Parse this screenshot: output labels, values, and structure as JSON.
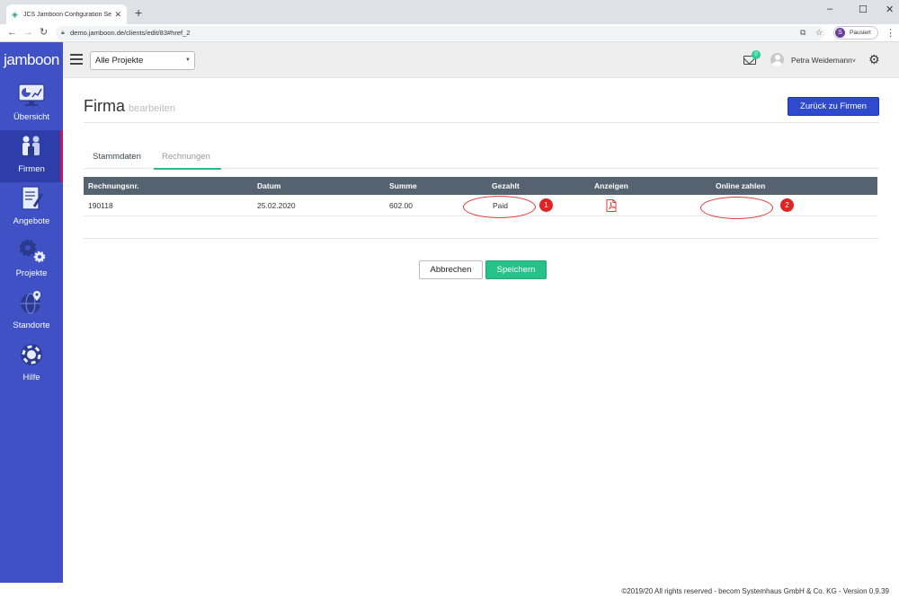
{
  "browser": {
    "tab_title": "JCS Jamboon Configuration Servi",
    "tab_close": "✕",
    "new_tab": "+",
    "url": "demo.jamboon.de/clients/edit/83#href_2",
    "profile_initial": "S",
    "profile_status": "Pausiert",
    "window_controls": [
      "–",
      "☐",
      "✕"
    ]
  },
  "app": {
    "brand": "jamboon",
    "project_select": "Alle Projekte",
    "mail_count": "0",
    "user_name": "Petra Weidemann",
    "accent_color": "#3f51c5"
  },
  "sidebar": {
    "items": [
      {
        "label": "Übersicht",
        "icon": "dashboard-icon",
        "active": false
      },
      {
        "label": "Firmen",
        "icon": "people-icon",
        "active": true
      },
      {
        "label": "Angebote",
        "icon": "document-edit-icon",
        "active": false
      },
      {
        "label": "Projekte",
        "icon": "gears-icon",
        "active": false
      },
      {
        "label": "Standorte",
        "icon": "globe-pin-icon",
        "active": false
      },
      {
        "label": "Hilfe",
        "icon": "lifebuoy-icon",
        "active": false
      }
    ]
  },
  "page": {
    "title": "Firma",
    "subtitle": "bearbeiten",
    "back_button": "Zurück zu Firmen",
    "tabs": [
      {
        "label": "Stammdaten",
        "active": false
      },
      {
        "label": "Rechnungen",
        "active": true
      }
    ]
  },
  "invoices": {
    "columns": [
      "Rechnungsnr.",
      "Datum",
      "Summe",
      "Gezahlt",
      "Anzeigen",
      "Online zahlen"
    ],
    "rows": [
      {
        "number": "190118",
        "date": "25.02.2020",
        "sum": "602.00",
        "paid": "Paid",
        "view": "pdf-icon",
        "online": ""
      }
    ]
  },
  "annotations": [
    "1",
    "2"
  ],
  "actions": {
    "cancel": "Abbrechen",
    "save": "Speichern"
  },
  "footer": "©2019/20 All rights reserved - becom Systemhaus GmbH & Co. KG - Version 0.9.39"
}
